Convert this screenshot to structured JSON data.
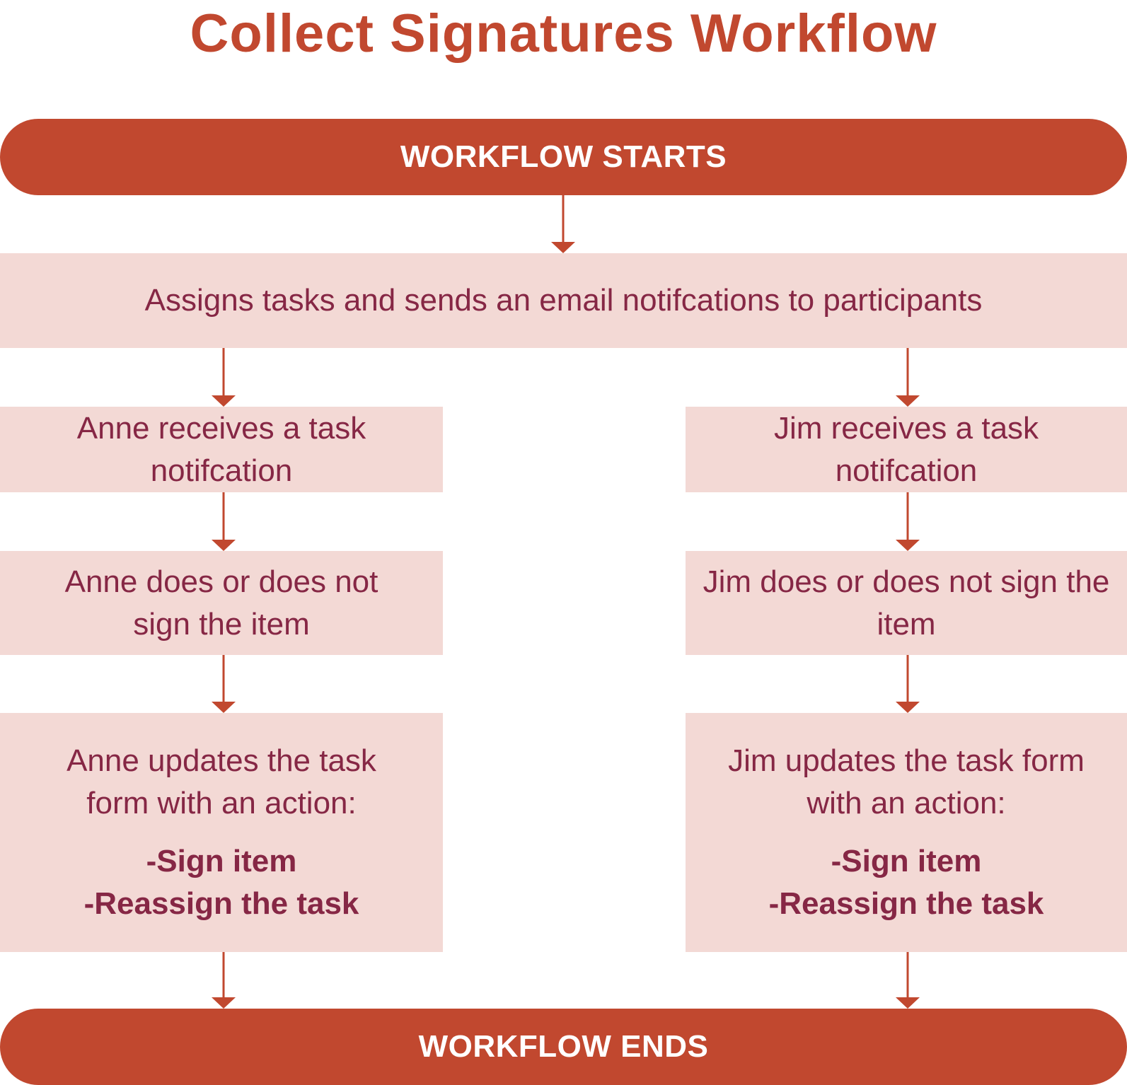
{
  "title": "Collect Signatures Workflow",
  "start_label": "WORKFLOW STARTS",
  "end_label": "WORKFLOW ENDS",
  "assign_step": "Assigns tasks and sends an email notifcations to participants",
  "branches": [
    {
      "receive": "Anne receives a task notifcation",
      "decide": "Anne does or does not sign the item",
      "update": "Anne updates the task form with an action:",
      "actions": [
        "-Sign item",
        "-Reassign the task"
      ]
    },
    {
      "receive": "Jim receives a task notifcation",
      "decide": "Jim does or does not sign the item",
      "update": "Jim updates the task form with an action:",
      "actions": [
        "-Sign item",
        "-Reassign the task"
      ]
    }
  ],
  "colors": {
    "accent": "#c1482f",
    "box_fill": "#f3d9d5",
    "box_text": "#862745"
  }
}
